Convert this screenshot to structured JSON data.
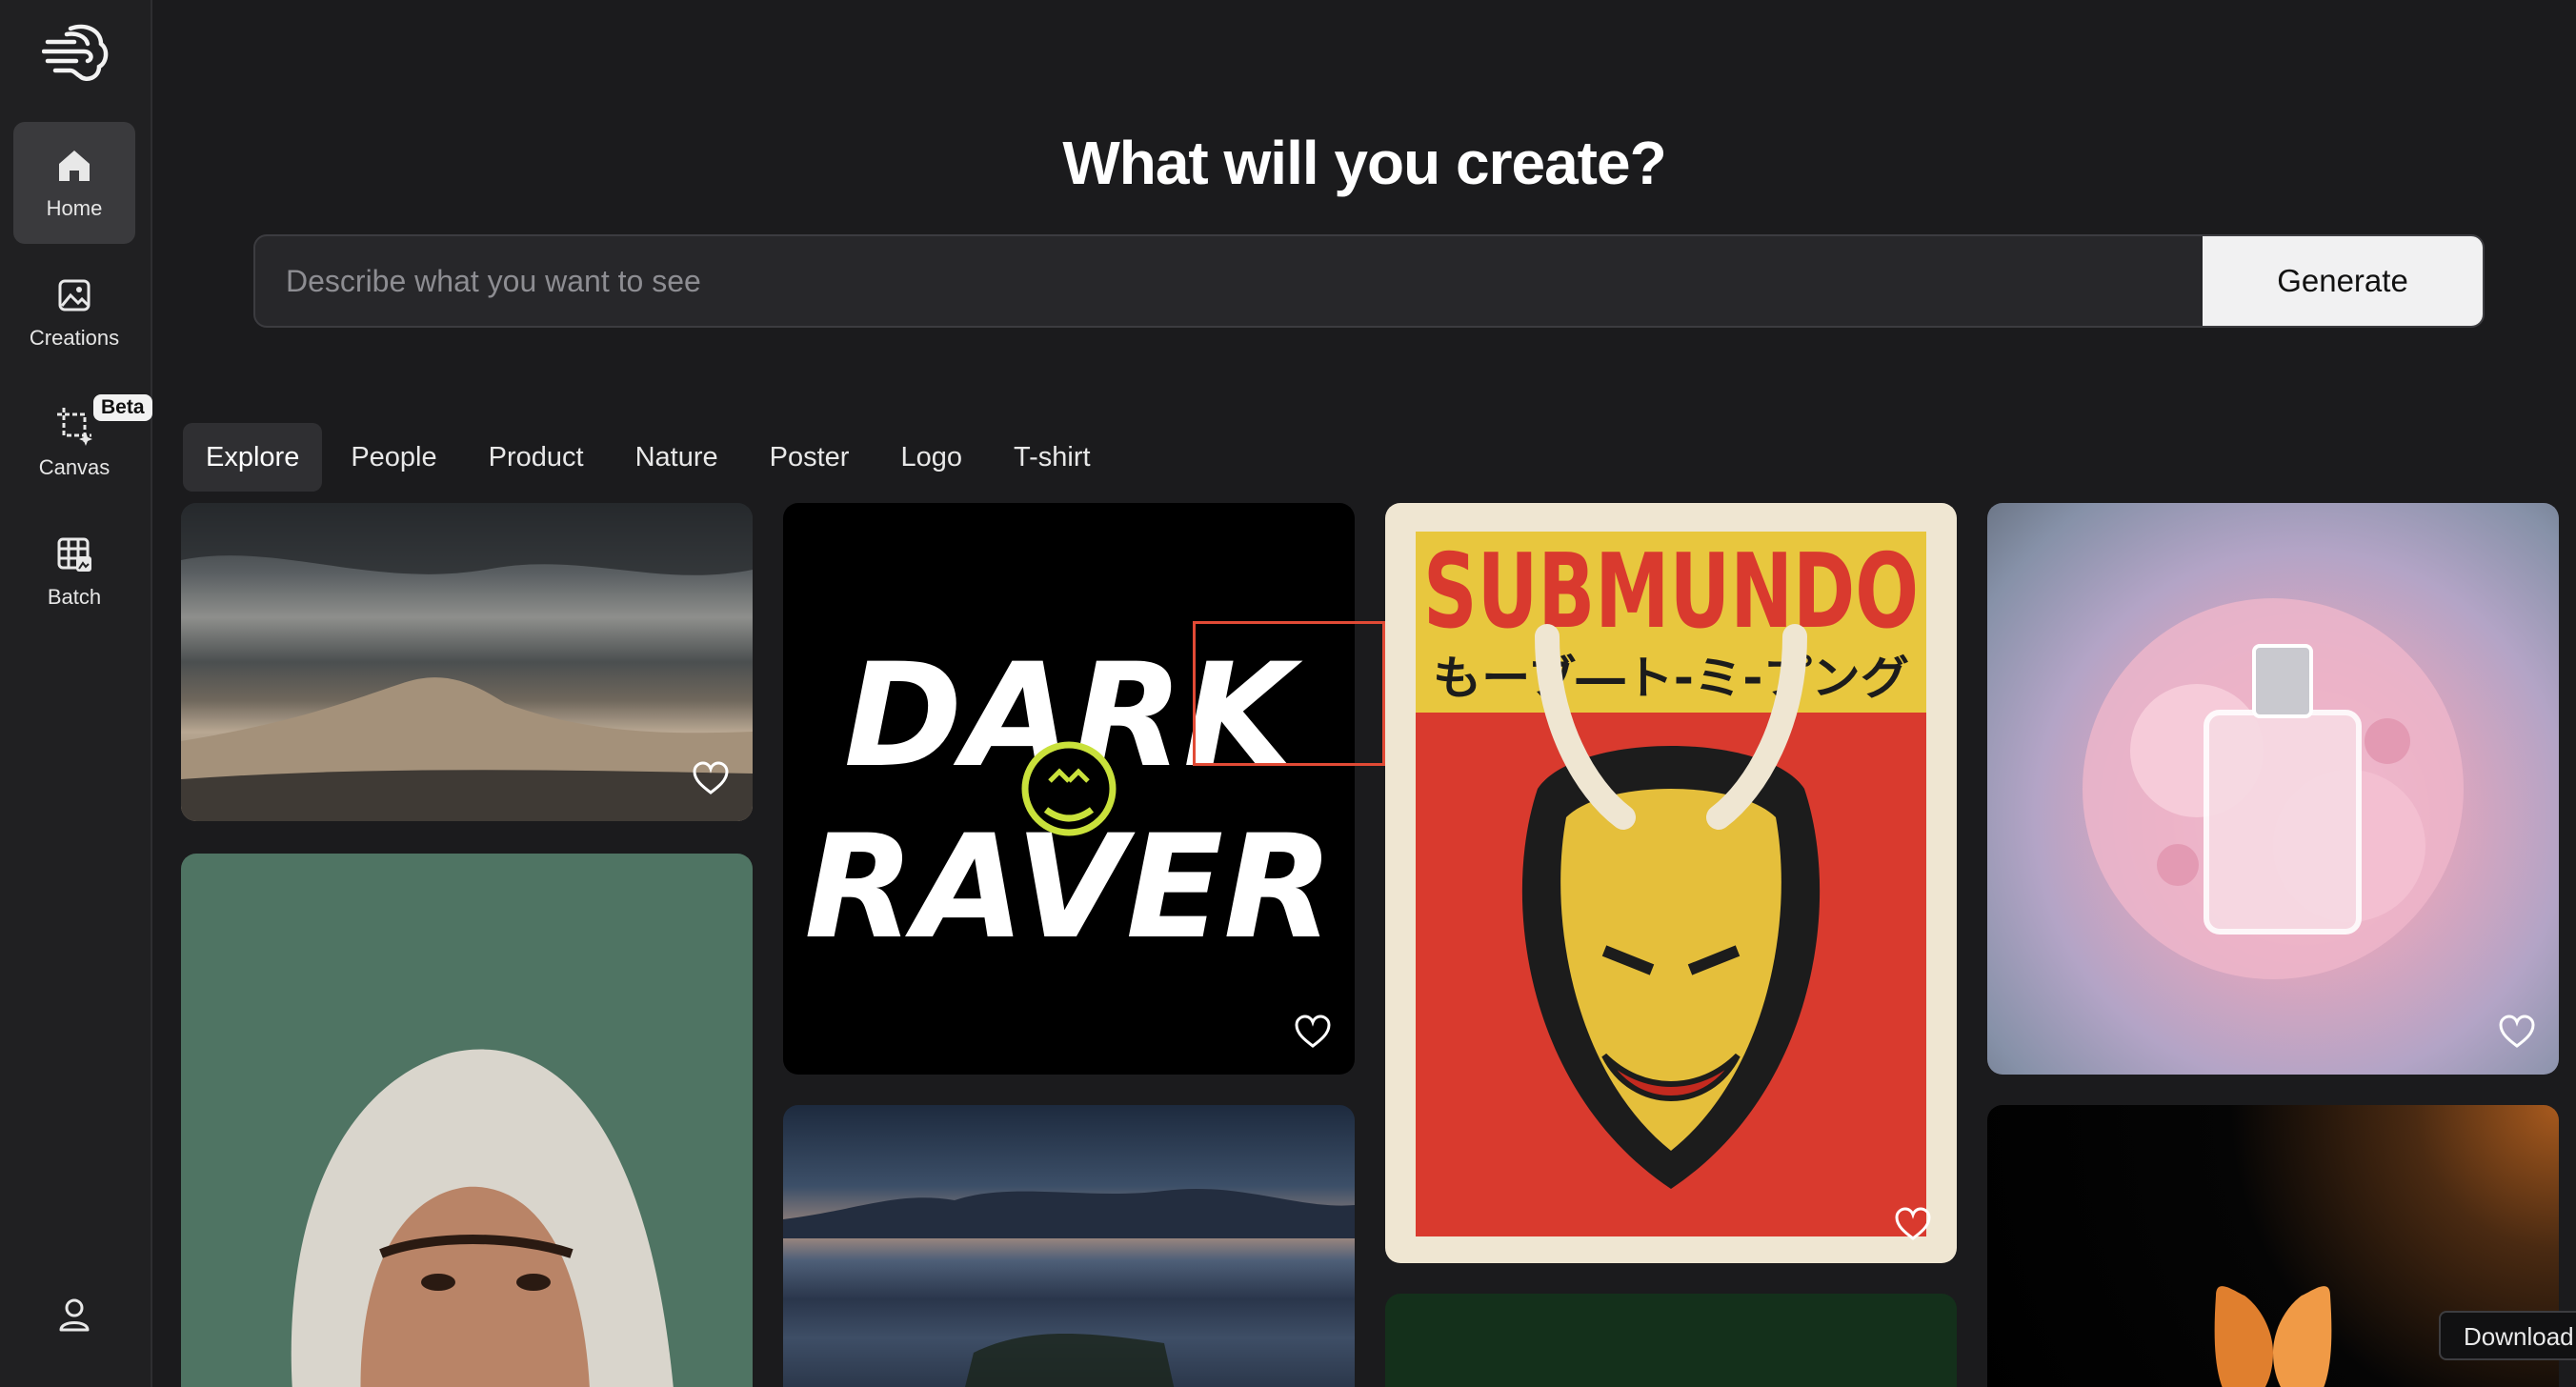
{
  "sidebar": {
    "items": [
      {
        "label": "Home",
        "icon": "home-icon",
        "active": true
      },
      {
        "label": "Creations",
        "icon": "image-icon"
      },
      {
        "label": "Canvas",
        "icon": "canvas-crop-icon",
        "badge": "Beta"
      },
      {
        "label": "Batch",
        "icon": "batch-grid-icon"
      }
    ],
    "profile_icon": "user-icon"
  },
  "hero": {
    "title": "What will you create?",
    "search_placeholder": "Describe what you want to see",
    "generate_label": "Generate"
  },
  "tabs": [
    {
      "label": "Explore",
      "active": true
    },
    {
      "label": "People"
    },
    {
      "label": "Product"
    },
    {
      "label": "Nature"
    },
    {
      "label": "Poster"
    },
    {
      "label": "Logo"
    },
    {
      "label": "T-shirt"
    }
  ],
  "gallery": {
    "raver_logo_lines": [
      "DARK",
      "RAVER"
    ],
    "poster_title": "SUBMUNDO",
    "poster_subtitle": "もーブ―ト-ミ-プング"
  },
  "tooltip": {
    "download_label": "Download"
  },
  "colors": {
    "background": "#1b1b1d",
    "sidebar": "#202022",
    "accent_selection": "#e14a35",
    "generate_button": "#f1f1f2"
  }
}
